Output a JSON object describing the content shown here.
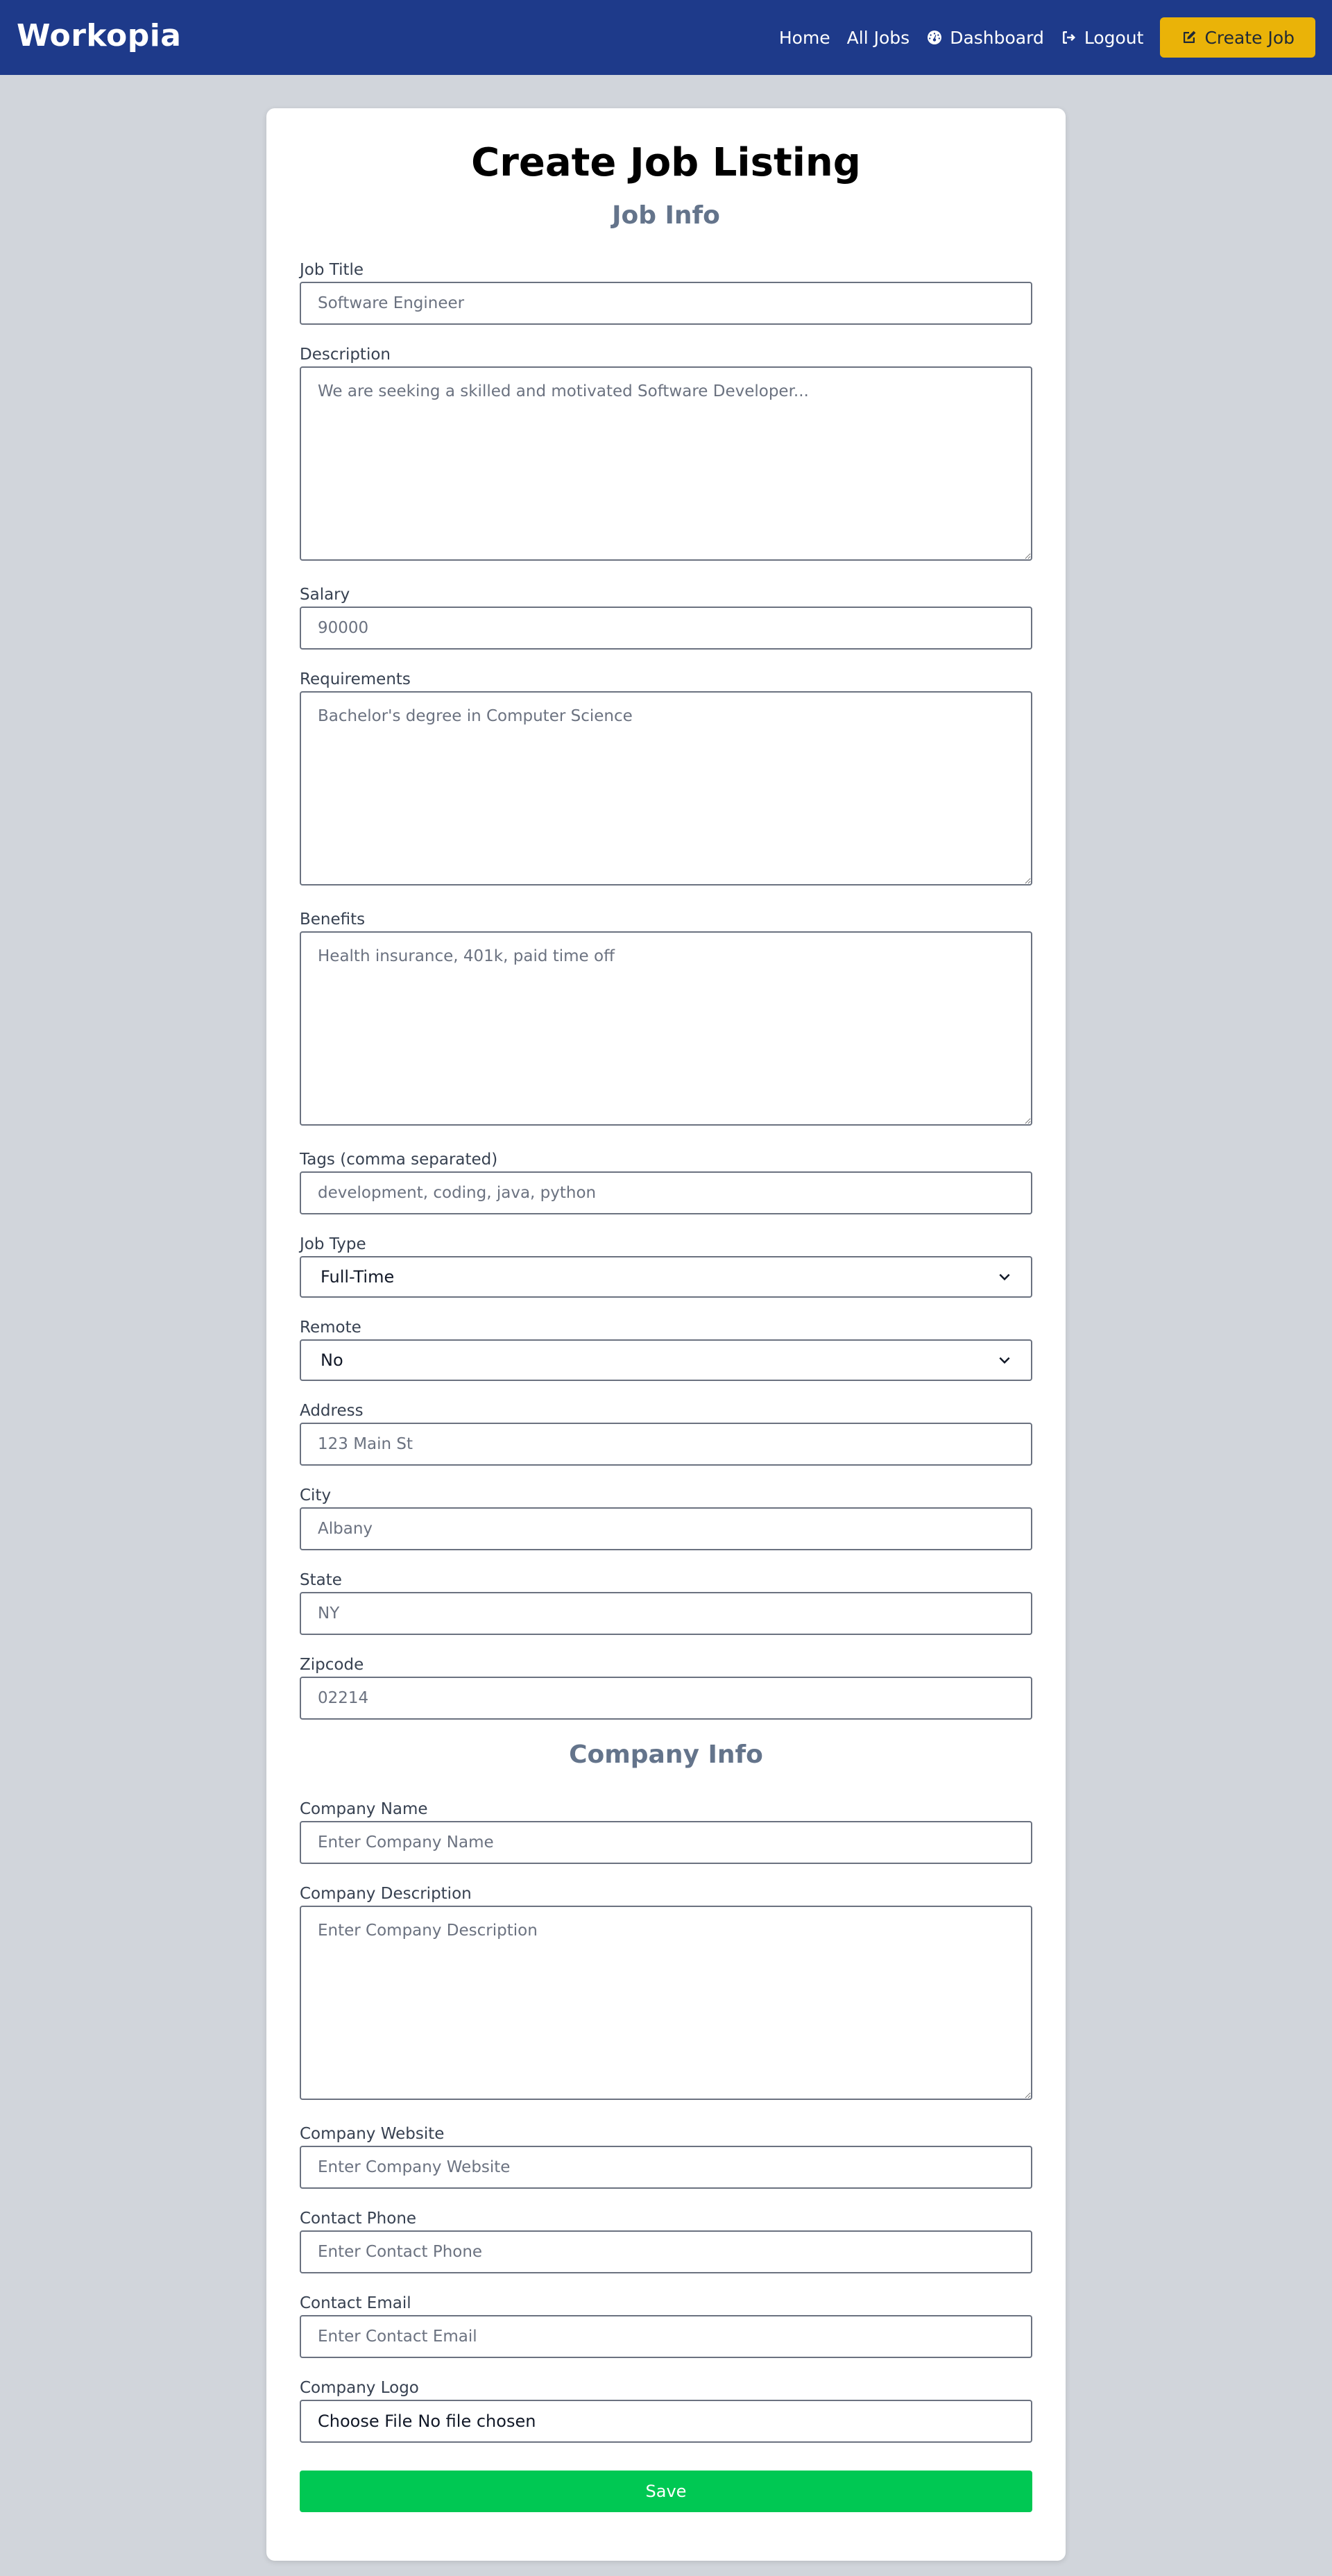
{
  "header": {
    "brand": "Workopia",
    "nav": [
      {
        "label": "Home",
        "icon": null
      },
      {
        "label": "All Jobs",
        "icon": null
      },
      {
        "label": "Dashboard",
        "icon": "gauge-icon"
      },
      {
        "label": "Logout",
        "icon": "logout-icon"
      }
    ],
    "create_button": {
      "label": "Create Job",
      "icon": "edit-icon"
    },
    "colors": {
      "bar": "#1e3a8a",
      "create_button": "#eab308"
    }
  },
  "form": {
    "title": "Create Job Listing",
    "job_info_heading": "Job Info",
    "job_title": {
      "label": "Job Title",
      "placeholder": "Software Engineer"
    },
    "description": {
      "label": "Description",
      "placeholder": "We are seeking a skilled and motivated Software Developer..."
    },
    "salary": {
      "label": "Salary",
      "placeholder": "90000"
    },
    "requirements": {
      "label": "Requirements",
      "placeholder": "Bachelor's degree in Computer Science"
    },
    "benefits": {
      "label": "Benefits",
      "placeholder": "Health insurance, 401k, paid time off"
    },
    "tags": {
      "label": "Tags (comma separated)",
      "placeholder": "development, coding, java, python"
    },
    "job_type": {
      "label": "Job Type",
      "value": "Full-Time"
    },
    "remote": {
      "label": "Remote",
      "value": "No"
    },
    "address": {
      "label": "Address",
      "placeholder": "123 Main St"
    },
    "city": {
      "label": "City",
      "placeholder": "Albany"
    },
    "state": {
      "label": "State",
      "placeholder": "NY"
    },
    "zipcode": {
      "label": "Zipcode",
      "placeholder": "02214"
    },
    "company_info_heading": "Company Info",
    "company_name": {
      "label": "Company Name",
      "placeholder": "Enter Company Name"
    },
    "company_description": {
      "label": "Company Description",
      "placeholder": "Enter Company Description"
    },
    "company_website": {
      "label": "Company Website",
      "placeholder": "Enter Company Website"
    },
    "contact_phone": {
      "label": "Contact Phone",
      "placeholder": "Enter Contact Phone"
    },
    "contact_email": {
      "label": "Contact Email",
      "placeholder": "Enter Contact Email"
    },
    "company_logo": {
      "label": "Company Logo",
      "button": "Choose File",
      "status": "No file chosen"
    },
    "save_label": "Save",
    "save_color": "#00c853"
  }
}
